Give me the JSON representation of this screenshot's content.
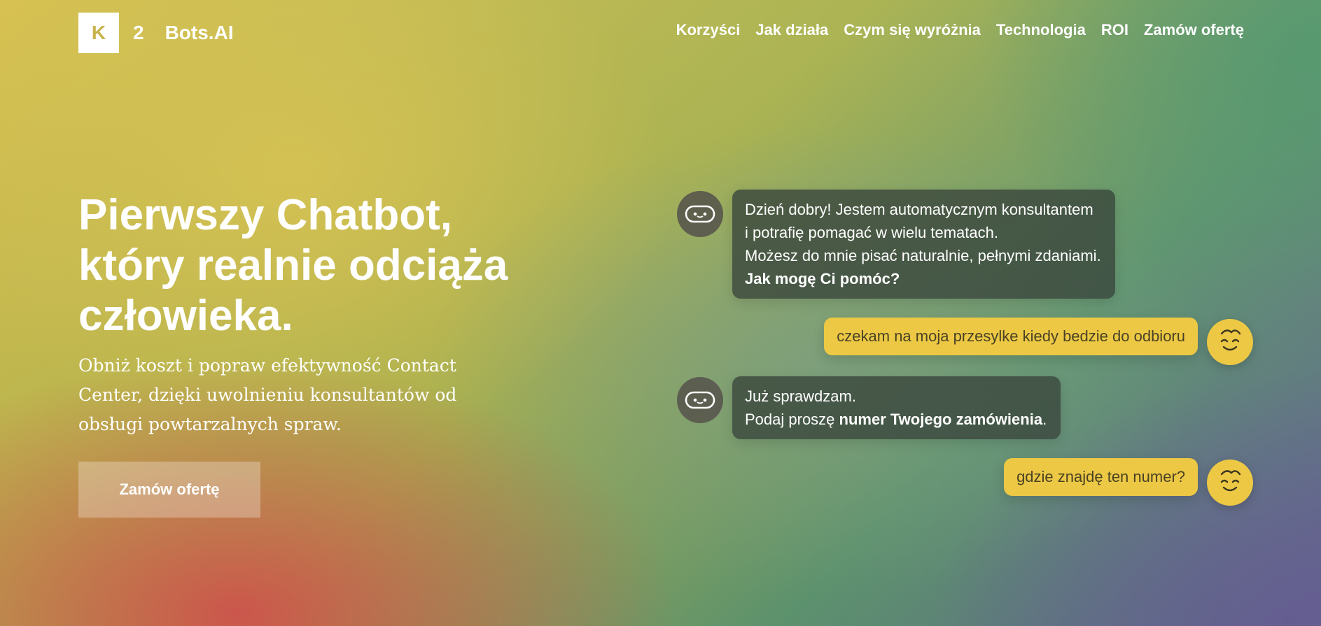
{
  "header": {
    "logo_letter": "K",
    "logo_number": "2",
    "logo_name": "Bots.AI",
    "nav": [
      {
        "label": "Korzyści"
      },
      {
        "label": "Jak działa"
      },
      {
        "label": "Czym się wyróżnia"
      },
      {
        "label": "Technologia"
      },
      {
        "label": "ROI"
      },
      {
        "label": "Zamów ofertę"
      }
    ]
  },
  "hero": {
    "title_lines": [
      "Pierwszy Chatbot,",
      "który realnie odciąża",
      "człowieka."
    ],
    "subtitle_lines": [
      "Obniż koszt i popraw efektywność Contact",
      "Center, dzięki uwolnieniu konsultantów od",
      "obsługi powtarzalnych spraw."
    ],
    "cta_label": "Zamów ofertę"
  },
  "chat": {
    "bot_1": {
      "lines": [
        "Dzień dobry! Jestem automatycznym konsultantem",
        "i potrafię pomagać w wielu tematach.",
        "Możesz do mnie pisać naturalnie, pełnymi zdaniami."
      ],
      "bold_line": "Jak mogę Ci pomóc?"
    },
    "user_1": "czekam na moja przesylke kiedy bedzie do odbioru",
    "bot_2": {
      "line_1": "Już sprawdzam.",
      "line_2_prefix": "Podaj proszę ",
      "line_2_bold": "numer Twojego zamówienia",
      "line_2_suffix": "."
    },
    "user_2": "gdzie znajdę ten numer?"
  },
  "colors": {
    "accent_yellow": "#ecc844",
    "bot_bubble": "#3a463c",
    "bot_avatar": "#56544c"
  },
  "icons": {
    "bot_avatar": "robot-face-icon",
    "user_avatar": "smiley-face-icon"
  }
}
